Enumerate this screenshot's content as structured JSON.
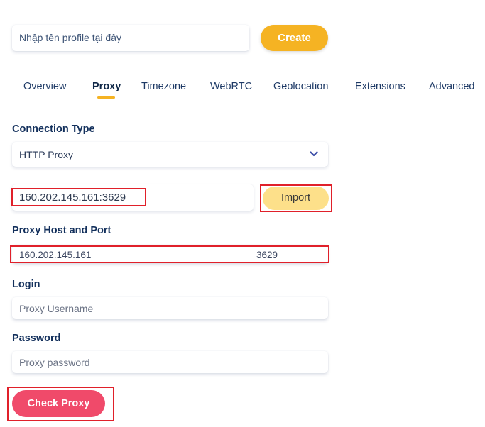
{
  "profile": {
    "name_placeholder": "Nhập tên profile tại đây",
    "create_label": "Create"
  },
  "tabs": [
    {
      "label": "Overview",
      "active": false
    },
    {
      "label": "Proxy",
      "active": true
    },
    {
      "label": "Timezone",
      "active": false
    },
    {
      "label": "WebRTC",
      "active": false
    },
    {
      "label": "Geolocation",
      "active": false
    },
    {
      "label": "Extensions",
      "active": false
    },
    {
      "label": "Advanced",
      "active": false
    }
  ],
  "connection": {
    "label": "Connection Type",
    "selected": "HTTP Proxy",
    "dropdown_icon": "chevron-down-icon"
  },
  "import": {
    "value": "160.202.145.161:3629",
    "button_label": "Import"
  },
  "host_port": {
    "label": "Proxy Host and Port",
    "host": "160.202.145.161",
    "port": "3629"
  },
  "login": {
    "label": "Login",
    "placeholder": "Proxy Username"
  },
  "password": {
    "label": "Password",
    "placeholder": "Proxy password"
  },
  "check_label": "Check Proxy",
  "colors": {
    "create": "#f5b323",
    "import": "#fde08a",
    "check": "#f04a6a",
    "tab_underline": "#f5b323",
    "highlight": "#e0202a"
  }
}
